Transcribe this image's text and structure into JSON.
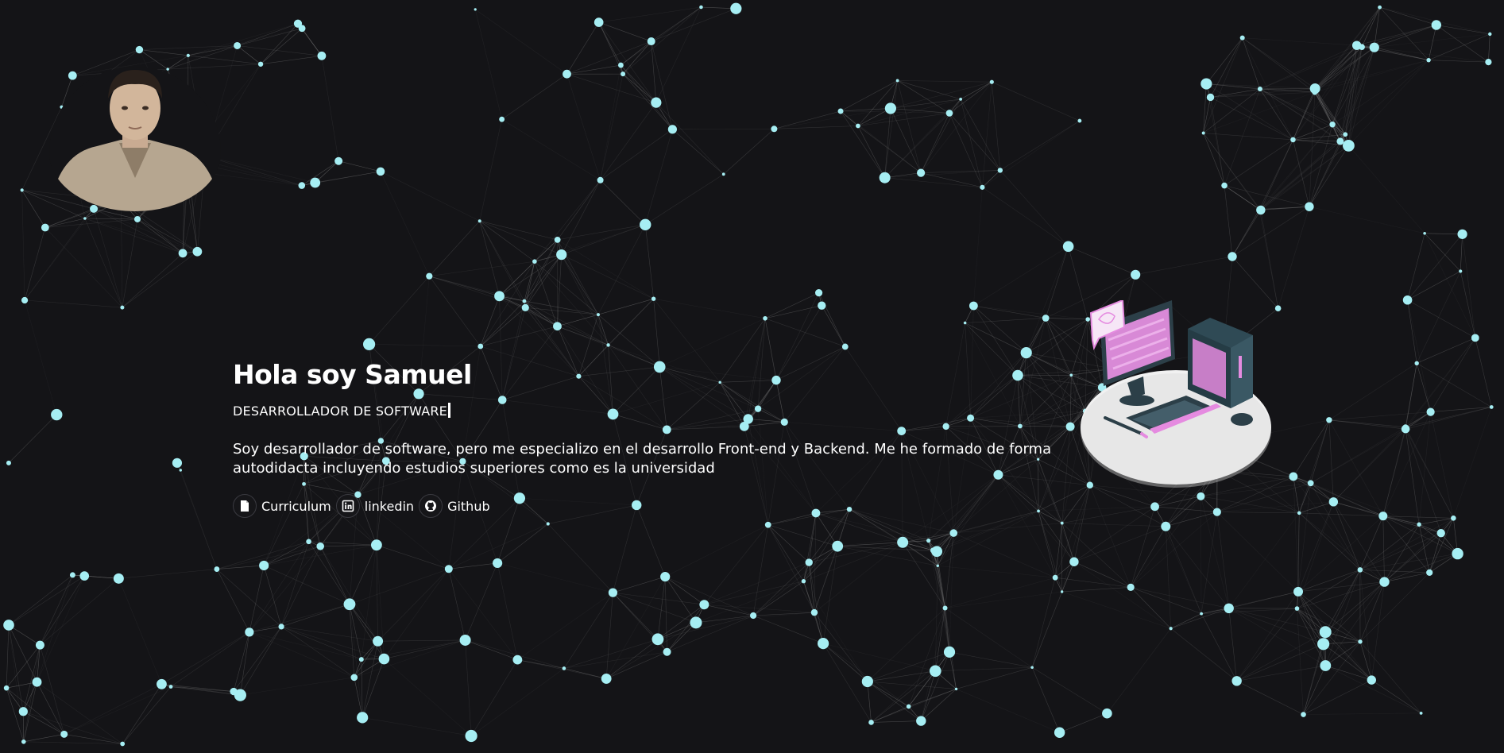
{
  "hero": {
    "title": "Hola soy Samuel",
    "subtitle": "DESARROLLADOR DE SOFTWARE",
    "description": "Soy desarrollador de software, pero me especializo en el desarrollo Front-end y Backend. Me he formado de forma autodidacta incluyendo estudios superiores como es la universidad"
  },
  "links": [
    {
      "label": "Curriculum",
      "icon": "document-icon"
    },
    {
      "label": "linkedin",
      "icon": "linkedin-icon"
    },
    {
      "label": "Github",
      "icon": "github-icon"
    }
  ],
  "colors": {
    "background": "#141417",
    "node": "#a6eef3",
    "line": "#8a8a8a",
    "text": "#ffffff",
    "accent_pink": "#e58be0"
  }
}
